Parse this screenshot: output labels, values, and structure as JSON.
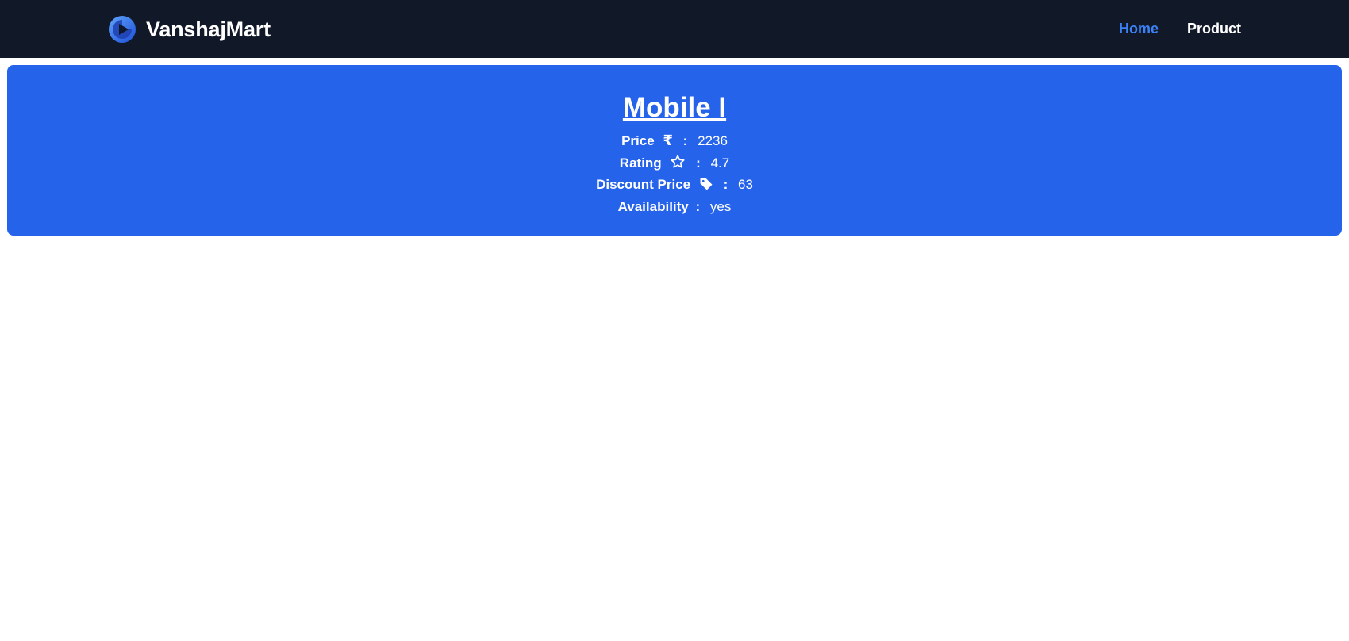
{
  "navbar": {
    "brand_name": "VanshajMart",
    "logo_icon": "play-circle-logo-icon",
    "links": [
      {
        "label": "Home",
        "active": true
      },
      {
        "label": "Product",
        "active": false
      }
    ],
    "active_color": "#3b82f6",
    "background": "#111827"
  },
  "product": {
    "title": "Mobile I",
    "price_label": "Price",
    "price_icon": "rupee-icon",
    "rupee_symbol": "₹",
    "price_value": "2236",
    "rating_label": "Rating",
    "rating_icon": "star-outline-icon",
    "rating_value": "4.7",
    "discount_label": "Discount Price",
    "discount_icon": "price-tag-icon",
    "discount_value": "63",
    "availability_label": "Availability",
    "availability_value": "yes",
    "separator": ":",
    "card_color": "#2563eb"
  }
}
